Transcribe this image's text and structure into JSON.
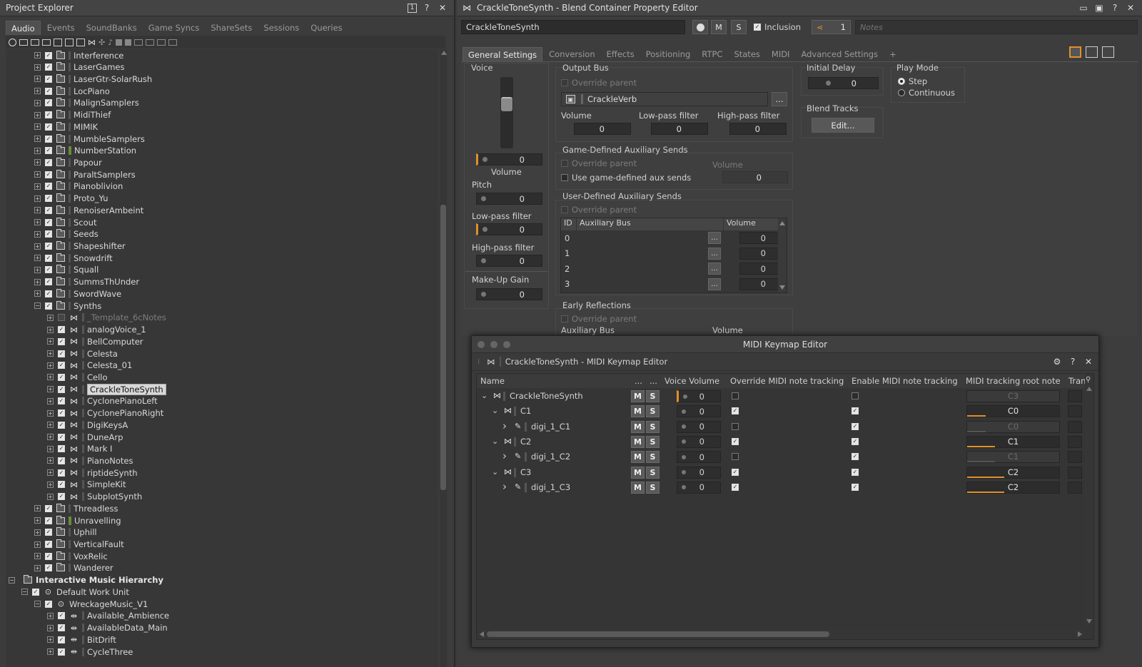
{
  "project_explorer": {
    "title": "Project Explorer",
    "tabs": [
      "Audio",
      "Events",
      "SoundBanks",
      "Game Syncs",
      "ShareSets",
      "Sessions",
      "Queries"
    ],
    "active_tab": "Audio",
    "tree": [
      {
        "label": "Interference",
        "indent": 1,
        "type": "folder",
        "expander": "+"
      },
      {
        "label": "LaserGames",
        "indent": 1,
        "type": "folder",
        "expander": "+"
      },
      {
        "label": "LaserGtr-SolarRush",
        "indent": 1,
        "type": "folder",
        "expander": "+"
      },
      {
        "label": "LocPiano",
        "indent": 1,
        "type": "folder",
        "expander": "+"
      },
      {
        "label": "MalignSamplers",
        "indent": 1,
        "type": "folder",
        "expander": "+"
      },
      {
        "label": "MidiThief",
        "indent": 1,
        "type": "folder",
        "expander": "+"
      },
      {
        "label": "MIMIK",
        "indent": 1,
        "type": "folder",
        "expander": "+"
      },
      {
        "label": "MumbleSamplers",
        "indent": 1,
        "type": "folder",
        "expander": "+"
      },
      {
        "label": "NumberStation",
        "indent": 1,
        "type": "colored",
        "color": "#6a8a3a",
        "expander": "+"
      },
      {
        "label": "Papour",
        "indent": 1,
        "type": "folder",
        "expander": "+"
      },
      {
        "label": "ParaltSamplers",
        "indent": 1,
        "type": "folder",
        "expander": "+"
      },
      {
        "label": "Pianoblivion",
        "indent": 1,
        "type": "folder",
        "expander": "+"
      },
      {
        "label": "Proto_Yu",
        "indent": 1,
        "type": "folder",
        "expander": "+"
      },
      {
        "label": "RenoiserAmbeint",
        "indent": 1,
        "type": "folder",
        "expander": "+"
      },
      {
        "label": "Scout",
        "indent": 1,
        "type": "folder",
        "expander": "+"
      },
      {
        "label": "Seeds",
        "indent": 1,
        "type": "folder",
        "expander": "+"
      },
      {
        "label": "Shapeshifter",
        "indent": 1,
        "type": "folder",
        "expander": "+"
      },
      {
        "label": "Snowdrift",
        "indent": 1,
        "type": "folder",
        "expander": "+"
      },
      {
        "label": "Squall",
        "indent": 1,
        "type": "folder",
        "expander": "+"
      },
      {
        "label": "SummsThUnder",
        "indent": 1,
        "type": "folder",
        "expander": "+"
      },
      {
        "label": "SwordWave",
        "indent": 1,
        "type": "folder",
        "expander": "+"
      },
      {
        "label": "Synths",
        "indent": 1,
        "type": "folder",
        "expander": "-"
      },
      {
        "label": "_Template_6cNotes",
        "indent": 2,
        "type": "blend",
        "expander": "+",
        "dim": true
      },
      {
        "label": "analogVoice_1",
        "indent": 2,
        "type": "blend",
        "expander": "+"
      },
      {
        "label": "BellComputer",
        "indent": 2,
        "type": "blend",
        "expander": "+"
      },
      {
        "label": "Celesta",
        "indent": 2,
        "type": "blend",
        "expander": "+"
      },
      {
        "label": "Celesta_01",
        "indent": 2,
        "type": "blend",
        "expander": "+"
      },
      {
        "label": "Cello",
        "indent": 2,
        "type": "blend",
        "expander": "+"
      },
      {
        "label": "CrackleToneSynth",
        "indent": 2,
        "type": "blend",
        "expander": "+",
        "selected": true
      },
      {
        "label": "CyclonePianoLeft",
        "indent": 2,
        "type": "blend",
        "expander": "+"
      },
      {
        "label": "CyclonePianoRight",
        "indent": 2,
        "type": "blend",
        "expander": "+"
      },
      {
        "label": "DigiKeysA",
        "indent": 2,
        "type": "blend",
        "expander": "+"
      },
      {
        "label": "DuneArp",
        "indent": 2,
        "type": "blend",
        "expander": "+"
      },
      {
        "label": "Mark I",
        "indent": 2,
        "type": "blend",
        "expander": "+"
      },
      {
        "label": "PianoNotes",
        "indent": 2,
        "type": "blend",
        "expander": "+"
      },
      {
        "label": "riptideSynth",
        "indent": 2,
        "type": "blend",
        "expander": "+"
      },
      {
        "label": "SimpleKit",
        "indent": 2,
        "type": "blend",
        "expander": "+"
      },
      {
        "label": "SubplotSynth",
        "indent": 2,
        "type": "blend",
        "expander": "+"
      },
      {
        "label": "Threadless",
        "indent": 1,
        "type": "folder",
        "expander": "+"
      },
      {
        "label": "Unravelling",
        "indent": 1,
        "type": "colored",
        "color": "#6a8a3a",
        "expander": "+"
      },
      {
        "label": "Uphill",
        "indent": 1,
        "type": "folder",
        "expander": "+"
      },
      {
        "label": "VerticalFault",
        "indent": 1,
        "type": "folder",
        "expander": "+"
      },
      {
        "label": "VoxRelic",
        "indent": 1,
        "type": "folder",
        "expander": "+"
      },
      {
        "label": "Wanderer",
        "indent": 1,
        "type": "folder",
        "expander": "+"
      },
      {
        "label": "Interactive Music Hierarchy",
        "indent": 0,
        "type": "root",
        "expander": "-",
        "bold": true
      },
      {
        "label": "Default Work Unit",
        "indent": 1,
        "type": "workunit",
        "expander": "-"
      },
      {
        "label": "WreckageMusic_V1",
        "indent": 2,
        "type": "workunit",
        "expander": "-"
      },
      {
        "label": "Available_Ambience",
        "indent": 3,
        "type": "playlist",
        "expander": "+"
      },
      {
        "label": "AvailableData_Main",
        "indent": 3,
        "type": "playlist",
        "expander": "+"
      },
      {
        "label": "BitDrift",
        "indent": 3,
        "type": "playlist",
        "expander": "+"
      },
      {
        "label": "CycleThree",
        "indent": 3,
        "type": "playlist",
        "expander": "+"
      }
    ]
  },
  "property_editor": {
    "title": "CrackleToneSynth - Blend Container Property Editor",
    "object_name": "CrackleToneSynth",
    "mute_label": "M",
    "solo_label": "S",
    "inclusion_label": "Inclusion",
    "share_count": "1",
    "notes_placeholder": "Notes",
    "tabs": [
      "General Settings",
      "Conversion",
      "Effects",
      "Positioning",
      "RTPC",
      "States",
      "MIDI",
      "Advanced Settings",
      "+"
    ],
    "active_tab": "General Settings",
    "voice": {
      "title": "Voice",
      "volume_value": "0",
      "volume_label": "Volume",
      "pitch_label": "Pitch",
      "pitch_value": "0",
      "lowpass_label": "Low-pass filter",
      "lowpass_value": "0",
      "highpass_label": "High-pass filter",
      "highpass_value": "0",
      "makeup_label": "Make-Up Gain",
      "makeup_value": "0"
    },
    "output_bus": {
      "title": "Output Bus",
      "override_label": "Override parent",
      "bus_name": "CrackleVerb",
      "browse_label": "...",
      "volume_label": "Volume",
      "volume_value": "0",
      "lowpass_label": "Low-pass filter",
      "lowpass_value": "0",
      "highpass_label": "High-pass filter",
      "highpass_value": "0"
    },
    "game_aux": {
      "title": "Game-Defined Auxiliary Sends",
      "override_label": "Override parent",
      "use_label": "Use game-defined aux sends",
      "volume_label": "Volume",
      "volume_value": "0"
    },
    "user_aux": {
      "title": "User-Defined Auxiliary Sends",
      "override_label": "Override parent",
      "col_id": "ID",
      "col_bus": "Auxiliary Bus",
      "col_volume": "Volume",
      "rows": [
        {
          "id": "0",
          "volume": "0"
        },
        {
          "id": "1",
          "volume": "0"
        },
        {
          "id": "2",
          "volume": "0"
        },
        {
          "id": "3",
          "volume": "0"
        }
      ],
      "browse_label": "..."
    },
    "early_reflections": {
      "title": "Early Reflections",
      "override_label": "Override parent",
      "bus_label": "Auxiliary Bus",
      "volume_label": "Volume"
    },
    "initial_delay": {
      "title": "Initial Delay",
      "value": "0"
    },
    "play_mode": {
      "title": "Play Mode",
      "step_label": "Step",
      "continuous_label": "Continuous",
      "selected": "Step"
    },
    "blend_tracks": {
      "title": "Blend Tracks",
      "edit_label": "Edit..."
    }
  },
  "keymap_editor": {
    "window_title": "MIDI Keymap Editor",
    "header_title": "CrackleToneSynth - MIDI Keymap Editor",
    "columns": [
      "Name",
      "...",
      "...",
      "Voice Volume",
      "Override MIDI note tracking",
      "Enable MIDI note tracking",
      "MIDI tracking root note",
      "Trans"
    ],
    "rows": [
      {
        "name": "CrackleToneSynth",
        "indent": 0,
        "type": "blend",
        "arrow": "v",
        "volume": "0",
        "override": false,
        "enable": false,
        "root_note": "C3",
        "root_dim": true,
        "fill": 0
      },
      {
        "name": "C1",
        "indent": 1,
        "type": "blend",
        "arrow": "v",
        "volume": "0",
        "override": true,
        "enable": true,
        "root_note": "C0",
        "root_dim": false,
        "fill": 0.2
      },
      {
        "name": "digi_1_C1",
        "indent": 2,
        "type": "sound",
        "arrow": ">",
        "volume": "0",
        "override": false,
        "enable": true,
        "root_note": "C0",
        "root_dim": true,
        "fill": 0.2
      },
      {
        "name": "C2",
        "indent": 1,
        "type": "blend",
        "arrow": "v",
        "volume": "0",
        "override": true,
        "enable": true,
        "root_note": "C1",
        "root_dim": false,
        "fill": 0.3
      },
      {
        "name": "digi_1_C2",
        "indent": 2,
        "type": "sound",
        "arrow": ">",
        "volume": "0",
        "override": false,
        "enable": true,
        "root_note": "C1",
        "root_dim": true,
        "fill": 0.3
      },
      {
        "name": "C3",
        "indent": 1,
        "type": "blend",
        "arrow": "v",
        "volume": "0",
        "override": true,
        "enable": true,
        "root_note": "C2",
        "root_dim": false,
        "fill": 0.4
      },
      {
        "name": "digi_1_C3",
        "indent": 2,
        "type": "sound",
        "arrow": ">",
        "volume": "0",
        "override": true,
        "enable": true,
        "root_note": "C2",
        "root_dim": false,
        "fill": 0.4
      }
    ],
    "mute_label": "M",
    "solo_label": "S"
  },
  "colors": {
    "accent_orange": "#e0902a",
    "selection": "#d8d8d8",
    "panel": "#3d3d3d"
  }
}
